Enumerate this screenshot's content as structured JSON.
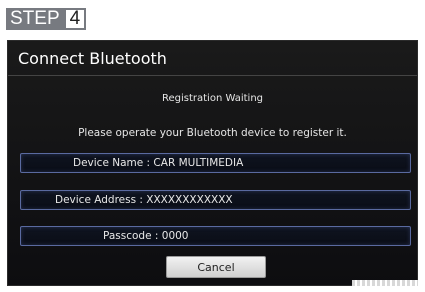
{
  "step": {
    "label": "STEP",
    "number": "4"
  },
  "dialog": {
    "title": "Connect Bluetooth",
    "status": "Registration Waiting",
    "instruction": "Please operate your Bluetooth device to register it.",
    "device_name": "Device Name : CAR MULTIMEDIA",
    "device_address": "Device Address : XXXXXXXXXXXX",
    "passcode": "Passcode : 0000",
    "cancel_label": "Cancel"
  },
  "colors": {
    "screen_bg": "#141414",
    "field_border": "#5a6aa0",
    "step_badge": "#777a80"
  }
}
